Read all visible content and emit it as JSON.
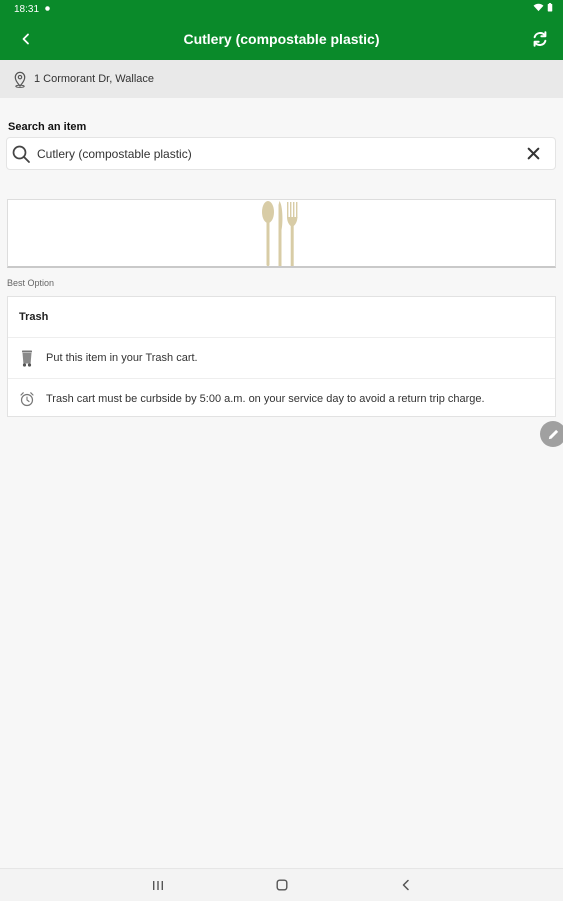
{
  "status_bar": {
    "time": "18:31"
  },
  "header": {
    "title": "Cutlery (compostable plastic)",
    "back_icon": "chevron-left-icon",
    "refresh_icon": "refresh-icon"
  },
  "address": {
    "text": "1 Cormorant Dr, Wallace",
    "icon": "location-pin-icon"
  },
  "search": {
    "label": "Search an item",
    "value": "Cutlery (compostable plastic)",
    "icon": "search-icon",
    "clear_icon": "close-icon"
  },
  "best_option": {
    "section_label": "Best Option",
    "title": "Trash",
    "instructions": [
      {
        "icon": "trash-cart-icon",
        "text": "Put this item in your Trash cart."
      },
      {
        "icon": "alarm-clock-icon",
        "text": "Trash cart must be curbside by 5:00 a.m. on your service day to avoid a return trip charge."
      }
    ]
  },
  "colors": {
    "header": "#0a8a2a",
    "cutlery": "#d8cca6"
  }
}
